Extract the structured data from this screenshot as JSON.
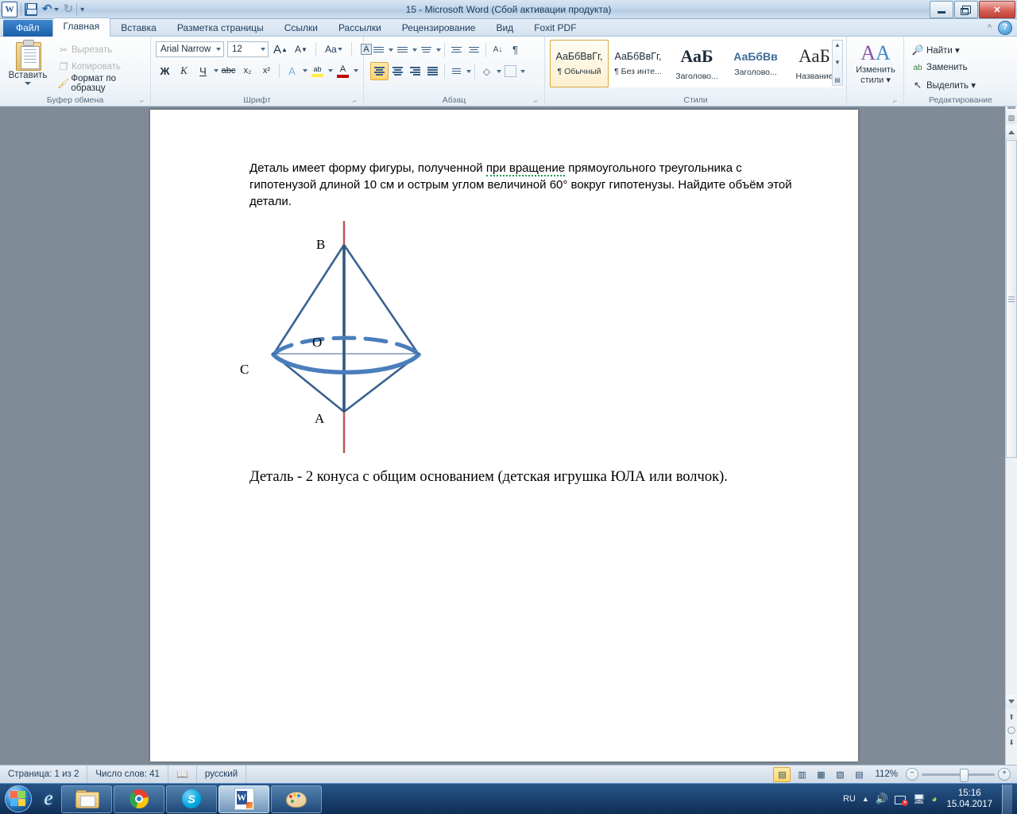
{
  "window": {
    "title": "15  -  Microsoft Word (Сбой активации продукта)",
    "quick_access": {
      "word_logo": "W",
      "save": "save-icon",
      "undo": "↶",
      "redo": "↻",
      "customize": "▾"
    },
    "buttons": {
      "minimize": "",
      "restore": "",
      "close": "✕"
    }
  },
  "ribbon": {
    "tabs": [
      {
        "label": "Файл",
        "kind": "file"
      },
      {
        "label": "Главная",
        "kind": "active"
      },
      {
        "label": "Вставка",
        "kind": "normal"
      },
      {
        "label": "Разметка страницы",
        "kind": "normal"
      },
      {
        "label": "Ссылки",
        "kind": "normal"
      },
      {
        "label": "Рассылки",
        "kind": "normal"
      },
      {
        "label": "Рецензирование",
        "kind": "normal"
      },
      {
        "label": "Вид",
        "kind": "normal"
      },
      {
        "label": "Foxit PDF",
        "kind": "normal"
      }
    ],
    "help_icon": "?",
    "collapse_icon": "^",
    "groups": {
      "clipboard": {
        "label": "Буфер обмена",
        "paste": "Вставить",
        "items": [
          {
            "label": "Вырезать",
            "icon": "scissors-icon",
            "glyph": "✂",
            "enabled": false
          },
          {
            "label": "Копировать",
            "icon": "copy-icon",
            "glyph": "❐",
            "enabled": false
          },
          {
            "label": "Формат по образцу",
            "icon": "format-painter-icon",
            "glyph": "🖌",
            "enabled": true
          }
        ]
      },
      "font": {
        "label": "Шрифт",
        "font_name": "Arial Narrow",
        "font_size": "12",
        "grow": "A",
        "shrink": "A",
        "case": "Aa",
        "clear": "clear-formatting-icon",
        "bold": "Ж",
        "italic": "К",
        "underline": "Ч",
        "strike": "abc",
        "subscript": "x₂",
        "superscript": "x²",
        "text_effects": "A",
        "highlight": "ab",
        "font_color": "A"
      },
      "paragraph": {
        "label": "Абзац",
        "bullets": "bullet-list-icon",
        "numbering": "numbered-list-icon",
        "multilevel": "multilevel-list-icon",
        "dec_indent": "decrease-indent-icon",
        "inc_indent": "increase-indent-icon",
        "sort": "sort-icon",
        "marks": "¶",
        "align_left": "align-left-icon",
        "align_center": "align-center-icon",
        "align_right": "align-right-icon",
        "justify": "justify-icon",
        "line_spacing": "line-spacing-icon",
        "shading": "shading-icon",
        "borders": "borders-icon"
      },
      "styles": {
        "label": "Стили",
        "items": [
          {
            "sample": "АаБбВвГг,",
            "name": "¶ Обычный",
            "selected": true,
            "variant": "normal"
          },
          {
            "sample": "АаБбВвГг,",
            "name": "¶ Без инте...",
            "selected": false,
            "variant": "normal"
          },
          {
            "sample": "АаБ",
            "name": "Заголово...",
            "selected": false,
            "variant": "h1"
          },
          {
            "sample": "АаБбВв",
            "name": "Заголово...",
            "selected": false,
            "variant": "h2"
          },
          {
            "sample": "АаБ",
            "name": "Название",
            "selected": false,
            "variant": "ttl"
          }
        ],
        "scroll": {
          "up": "▲",
          "down": "▼",
          "more": "▤"
        }
      },
      "change_styles": {
        "label_line1": "Изменить",
        "label_line2": "стили ▾",
        "icon": "change-styles-icon"
      },
      "editing": {
        "label": "Редактирование",
        "items": [
          {
            "label": "Найти ▾",
            "icon": "binoculars-icon",
            "glyph": "🔍"
          },
          {
            "label": "Заменить",
            "icon": "replace-icon",
            "glyph": "ab"
          },
          {
            "label": "Выделить ▾",
            "icon": "select-icon",
            "glyph": "↖"
          }
        ]
      }
    }
  },
  "document": {
    "paragraph1_part1": "Деталь имеет форму фигуры, полученной ",
    "paragraph1_spell": "при вращение",
    "paragraph1_part2": " прямоугольного треугольника с гипотенузой длиной 10 см и острым углом величиной 60° вокруг гипотенузы. Найдите объём этой детали.",
    "closing": "Деталь  - 2 конуса с общим основанием (детская игрушка ЮЛА или волчок).",
    "figure": {
      "name": "two-cones-spinning-top-diagram",
      "labels": {
        "top": "B",
        "center": "O",
        "left": "C",
        "bottom": "A"
      },
      "axis_color": "#c0504d",
      "outline_color": "#3b6291",
      "ellipse_color": "#4a7ebb"
    }
  },
  "statusbar": {
    "page": "Страница: 1 из 2",
    "words": "Число слов: 41",
    "proofing_icon": "spell-check-icon",
    "language": "русский",
    "views": [
      {
        "name": "print-layout",
        "glyph": "▤",
        "selected": true
      },
      {
        "name": "full-screen-reading",
        "glyph": "▥",
        "selected": false
      },
      {
        "name": "web-layout",
        "glyph": "▦",
        "selected": false
      },
      {
        "name": "outline",
        "glyph": "▧",
        "selected": false
      },
      {
        "name": "draft",
        "glyph": "▤",
        "selected": false
      }
    ],
    "zoom": "112%",
    "zoom_out": "−",
    "zoom_in": "+"
  },
  "taskbar": {
    "start": "start-orb",
    "pinned": [
      {
        "name": "internet-explorer",
        "glyph": "e",
        "active": false
      },
      {
        "name": "windows-explorer",
        "glyph": "folder",
        "active": false
      },
      {
        "name": "google-chrome",
        "glyph": "chrome",
        "active": false
      },
      {
        "name": "skype",
        "glyph": "S",
        "active": false
      },
      {
        "name": "microsoft-word",
        "glyph": "W",
        "active": true
      },
      {
        "name": "paint",
        "glyph": "palette",
        "active": false
      }
    ],
    "tray": {
      "language": "RU",
      "show_hidden": "▲",
      "volume": "volume-icon",
      "network": "network-icon",
      "action_center": "flag-icon",
      "antivirus": "shield-icon",
      "time": "15:16",
      "date": "15.04.2017"
    }
  }
}
